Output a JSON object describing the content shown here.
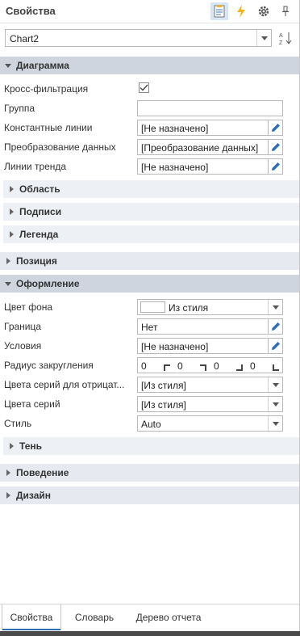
{
  "header": {
    "title": "Свойства",
    "icons": [
      "properties-icon",
      "events-icon",
      "settings-icon",
      "pin-icon"
    ]
  },
  "component_select": {
    "value": "Chart2",
    "sort_icon": "sort-az-icon"
  },
  "categories": {
    "chart": {
      "label": "Диаграмма",
      "rows": {
        "cross_filter": {
          "label": "Кросс-фильтрация",
          "checked": true
        },
        "group": {
          "label": "Группа",
          "value": ""
        },
        "constant_lines": {
          "label": "Константные линии",
          "value": "[Не назначено]"
        },
        "data_transform": {
          "label": "Преобразование данных",
          "value": "[Преобразование данных]"
        },
        "trend_lines": {
          "label": "Линии тренда",
          "value": "[Не назначено]"
        }
      },
      "subcategories": {
        "area": "Область",
        "labels": "Подписи",
        "legend": "Легенда"
      }
    },
    "position": {
      "label": "Позиция"
    },
    "appearance": {
      "label": "Оформление",
      "rows": {
        "background": {
          "label": "Цвет фона",
          "value": "Из стиля"
        },
        "border": {
          "label": "Граница",
          "value": "Нет"
        },
        "conditions": {
          "label": "Условия",
          "value": "[Не назначено]"
        },
        "corner_radius": {
          "label": "Радиус закругления",
          "values": [
            "0",
            "0",
            "0",
            "0"
          ]
        },
        "negative_series_colors": {
          "label": "Цвета серий для отрицат...",
          "value": "[Из стиля]"
        },
        "series_colors": {
          "label": "Цвета серий",
          "value": "[Из стиля]"
        },
        "style": {
          "label": "Стиль",
          "value": "Auto"
        }
      },
      "subcategories": {
        "shadow": "Тень"
      }
    },
    "behavior": {
      "label": "Поведение"
    },
    "design": {
      "label": "Дизайн"
    }
  },
  "tabs": {
    "properties": "Свойства",
    "dictionary": "Словарь",
    "report_tree": "Дерево отчета"
  },
  "colors": {
    "category_bg": "#cfd5de",
    "subcategory_bg": "#edf0f5",
    "edit_icon": "#2e6fb3",
    "accent": "#2e6fb3"
  }
}
